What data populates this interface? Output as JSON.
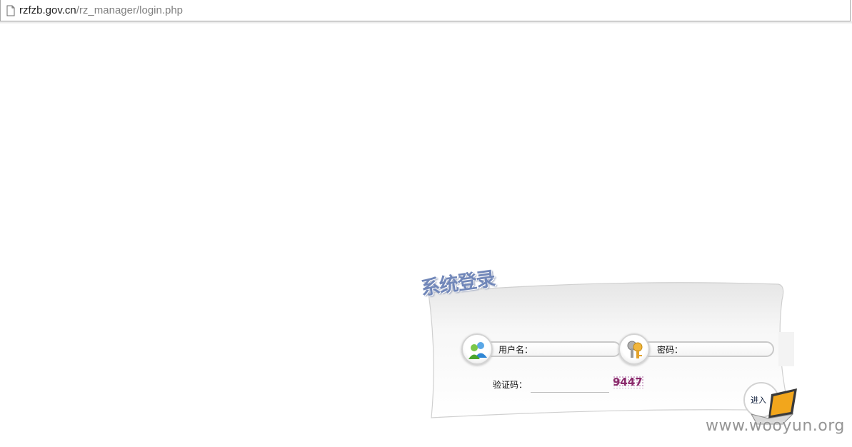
{
  "browser": {
    "url_host": "rzfzb.gov.cn",
    "url_path": "/rz_manager/login.php",
    "page_icon": "document-icon"
  },
  "login": {
    "title": "系统登录",
    "username_label": "用户名：",
    "username_icon": "users-icon",
    "password_label": "密码：",
    "password_icon": "keys-icon",
    "captcha_label": "验证码：",
    "captcha_code": "9447",
    "enter_label": "进入",
    "enter_icon": "laptop-icon"
  },
  "watermark": "www.wooyun.org",
  "colors": {
    "title": "#7187b9",
    "captcha": "#8b2a6b",
    "laptop_screen": "#f2a61c"
  }
}
